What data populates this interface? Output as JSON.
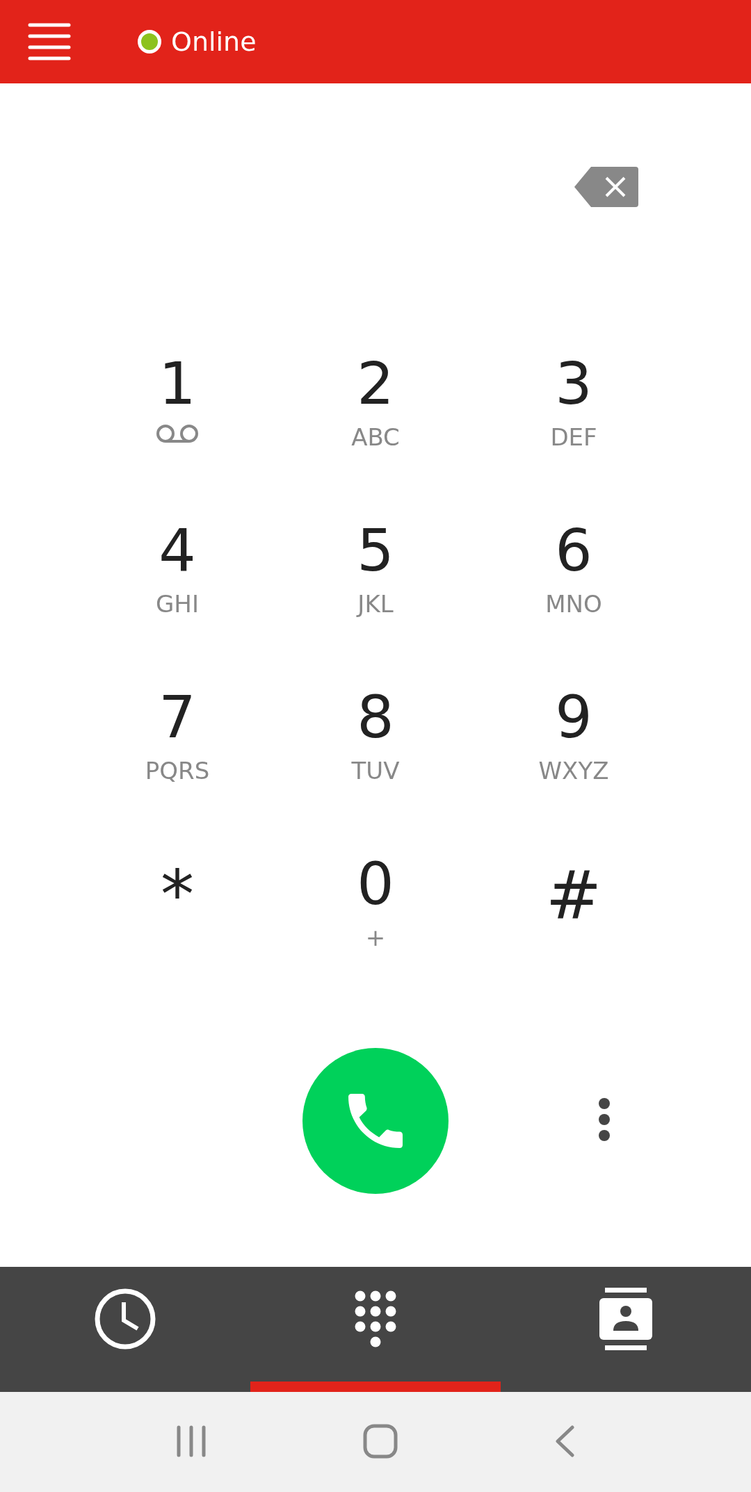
{
  "top_bar": {
    "status": {
      "label": "Online",
      "color": "#8dc21f"
    }
  },
  "keypad": [
    {
      "digit": "1",
      "kind": "voicemail"
    },
    {
      "digit": "2",
      "kind": "letters",
      "letters": "ABC"
    },
    {
      "digit": "3",
      "kind": "letters",
      "letters": "DEF"
    },
    {
      "digit": "4",
      "kind": "letters",
      "letters": "GHI"
    },
    {
      "digit": "5",
      "kind": "letters",
      "letters": "JKL"
    },
    {
      "digit": "6",
      "kind": "letters",
      "letters": "MNO"
    },
    {
      "digit": "7",
      "kind": "letters",
      "letters": "PQRS"
    },
    {
      "digit": "8",
      "kind": "letters",
      "letters": "TUV"
    },
    {
      "digit": "9",
      "kind": "letters",
      "letters": "WXYZ"
    },
    {
      "digit": "*",
      "kind": "symbol"
    },
    {
      "digit": "0",
      "kind": "letters",
      "letters": "+"
    },
    {
      "digit": "#",
      "kind": "symbol"
    }
  ],
  "tabs": [
    {
      "kind": "recents",
      "selected": false
    },
    {
      "kind": "keypad",
      "selected": true
    },
    {
      "kind": "contacts",
      "selected": false
    }
  ]
}
